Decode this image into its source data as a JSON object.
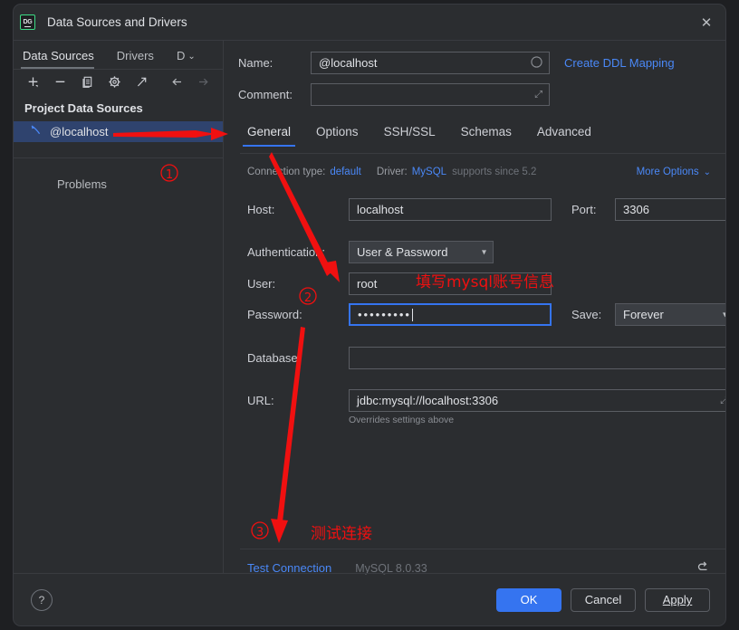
{
  "window": {
    "title": "Data Sources and Drivers",
    "logo_text": "DG",
    "close_icon": "✕"
  },
  "left_pane": {
    "tabs": [
      {
        "label": "Data Sources",
        "active": true
      },
      {
        "label": "Drivers",
        "active": false
      },
      {
        "label": "D",
        "active": false,
        "clipped": true
      }
    ],
    "overflow_chevron": "⌄",
    "toolbar_icons": [
      "add-icon",
      "remove-icon",
      "copy-icon",
      "gear-icon",
      "external-link-icon",
      "back-arrow-icon",
      "forward-arrow-icon"
    ],
    "section_title": "Project Data Sources",
    "data_source": {
      "name": "@localhost",
      "icon": "mysql-datasource-icon"
    },
    "problems_label": "Problems"
  },
  "form": {
    "name_label": "Name:",
    "name_value": "@localhost",
    "create_ddl_link": "Create DDL Mapping",
    "comment_label": "Comment:",
    "comment_value": "",
    "comment_expand_icon": "⤢"
  },
  "detail_tabs": [
    {
      "label": "General",
      "active": true
    },
    {
      "label": "Options",
      "active": false
    },
    {
      "label": "SSH/SSL",
      "active": false
    },
    {
      "label": "Schemas",
      "active": false
    },
    {
      "label": "Advanced",
      "active": false
    }
  ],
  "meta": {
    "connection_type_label": "Connection type:",
    "connection_type_value": "default",
    "driver_label": "Driver:",
    "driver_value": "MySQL",
    "driver_support": "supports since 5.2",
    "more_options": "More Options",
    "more_options_chevron": "⌄"
  },
  "general": {
    "host_label": "Host:",
    "host_value": "localhost",
    "port_label": "Port:",
    "port_value": "3306",
    "auth_label": "Authentication:",
    "auth_value": "User & Password",
    "user_label": "User:",
    "user_value": "root",
    "password_label": "Password:",
    "password_value": "•••••••••",
    "save_label": "Save:",
    "save_value": "Forever",
    "database_label": "Database:",
    "database_value": "",
    "url_label": "URL:",
    "url_value": "jdbc:mysql://localhost:3306",
    "url_expand_icon": "⤢",
    "url_hint": "Overrides settings above"
  },
  "footer": {
    "test_connection": "Test Connection",
    "driver_version": "MySQL 8.0.33",
    "reset_icon": "↩"
  },
  "bottom_bar": {
    "help_label": "?",
    "ok_label": "OK",
    "cancel_label": "Cancel",
    "apply_label": "Apply"
  },
  "annotations": {
    "color": "#f01010",
    "marker_1": "①",
    "marker_2": "②",
    "marker_3": "③",
    "note_account": "填写mysql账号信息",
    "note_test": "测试连接"
  }
}
